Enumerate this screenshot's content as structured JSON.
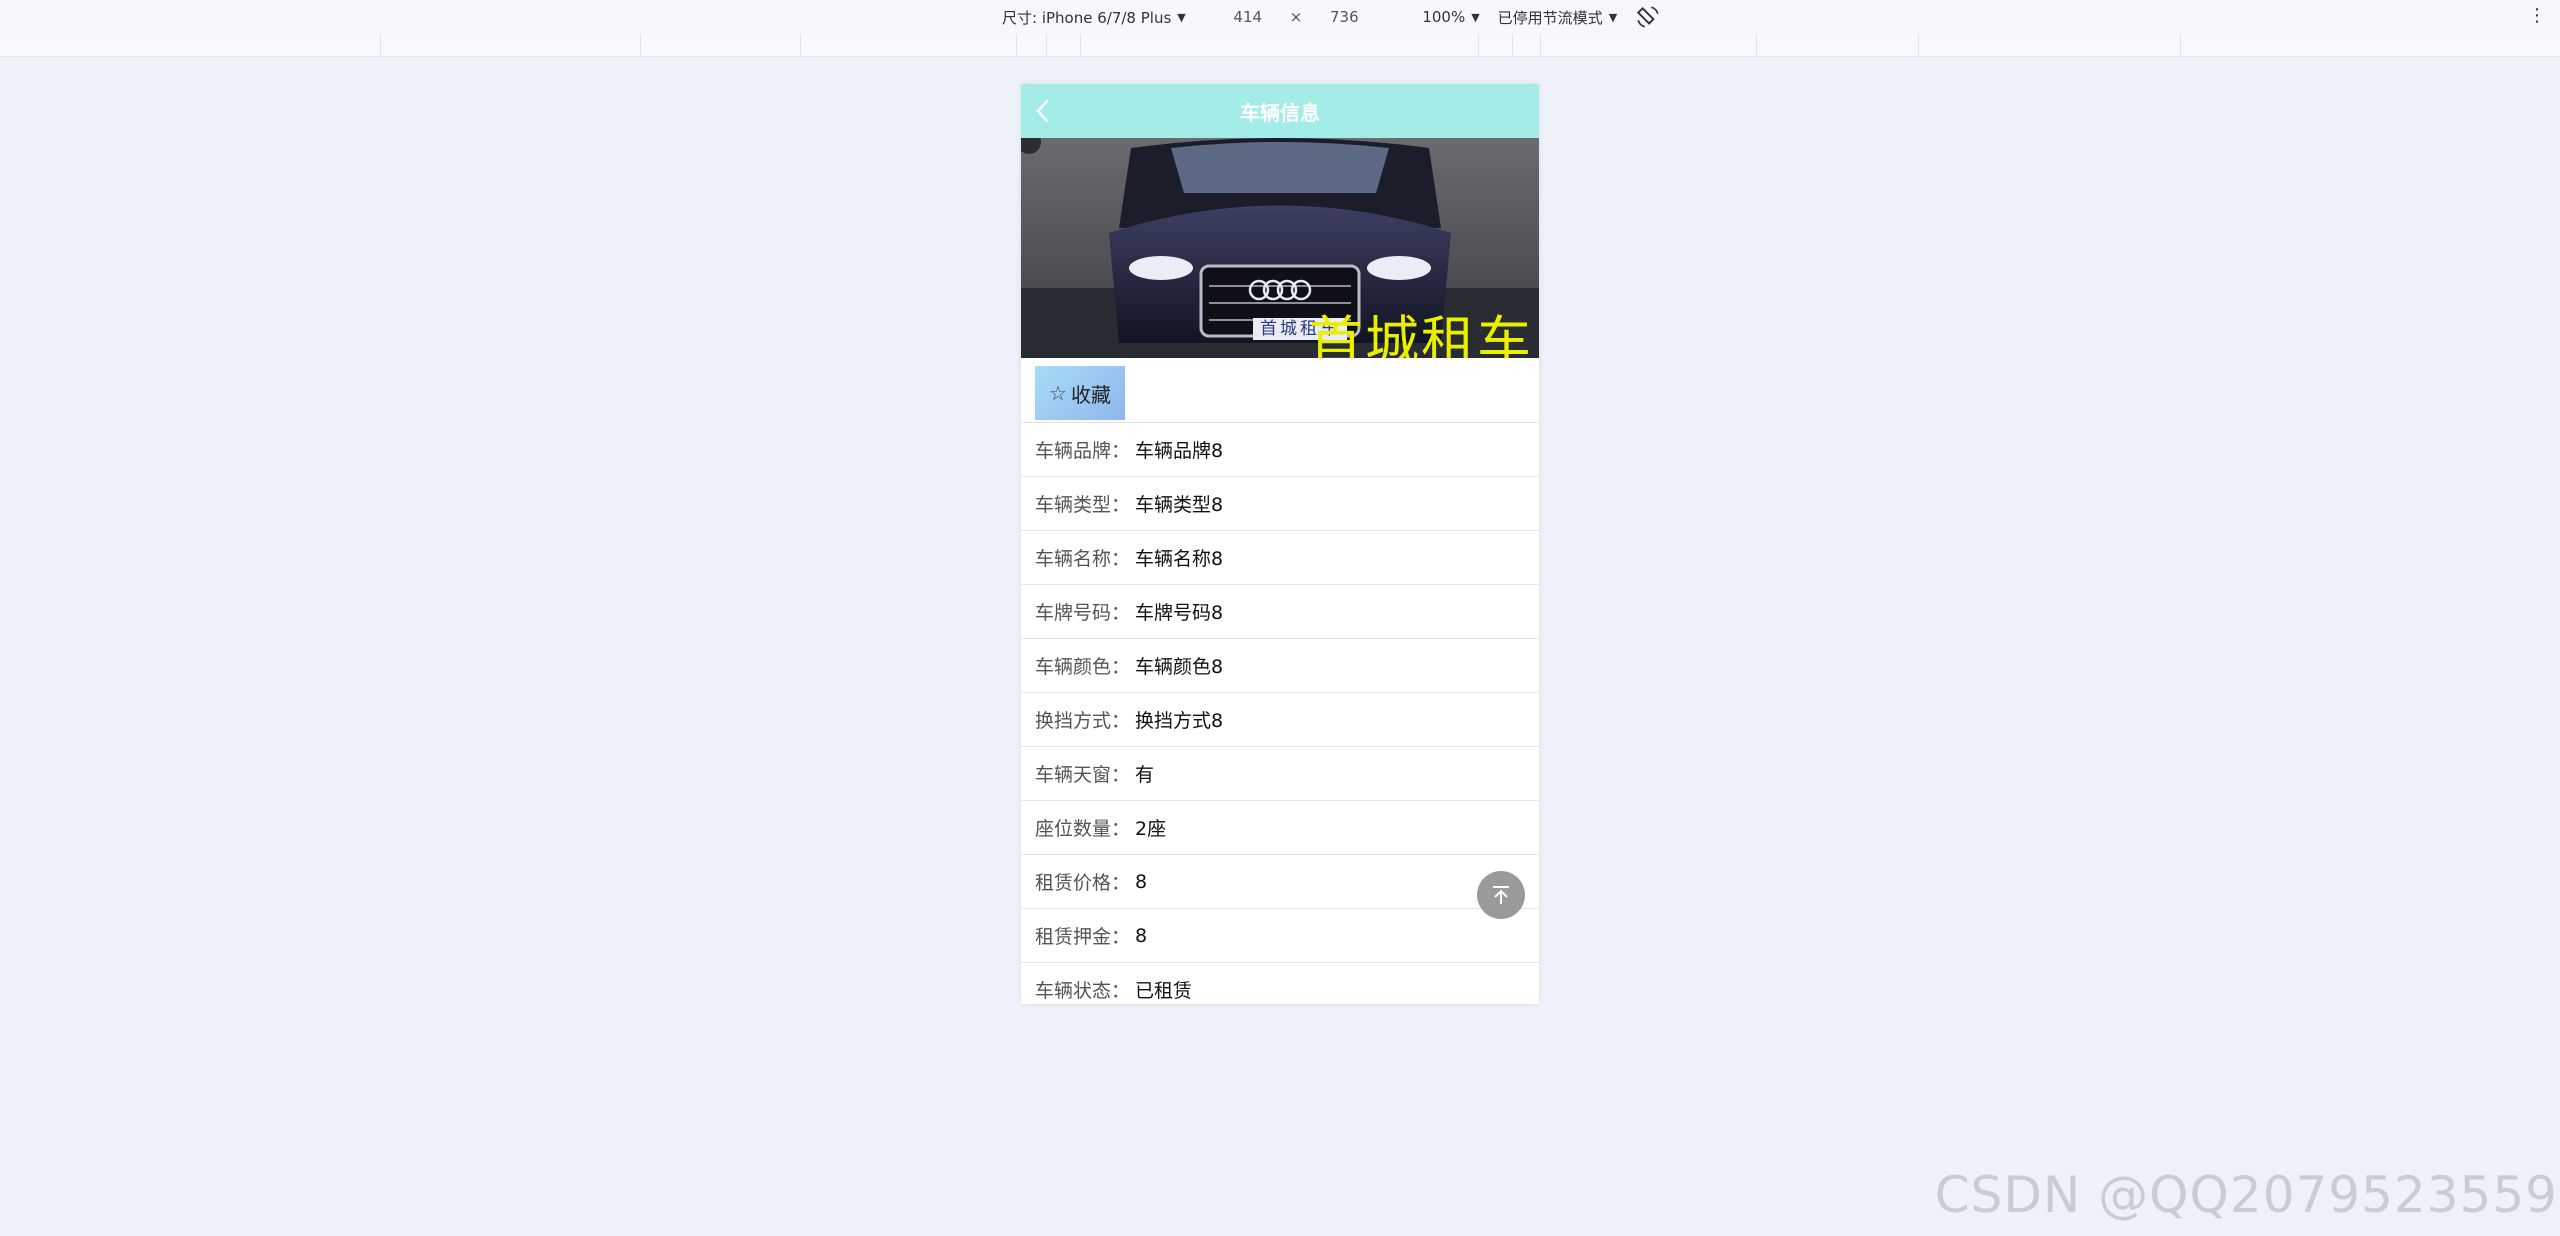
{
  "devtools": {
    "device_label": "尺寸: iPhone 6/7/8 Plus",
    "width": "414",
    "times": "×",
    "height": "736",
    "zoom": "100%",
    "throttle": "已停用节流模式"
  },
  "header": {
    "title": "车辆信息"
  },
  "hero": {
    "plate_text": "首城租车",
    "overlay_text": "首城租车"
  },
  "favorite": {
    "star": "☆",
    "label": "收藏"
  },
  "details": [
    {
      "label": "车辆品牌：",
      "value": "车辆品牌8"
    },
    {
      "label": "车辆类型：",
      "value": "车辆类型8"
    },
    {
      "label": "车辆名称：",
      "value": "车辆名称8"
    },
    {
      "label": "车牌号码：",
      "value": "车牌号码8"
    },
    {
      "label": "车辆颜色：",
      "value": "车辆颜色8"
    },
    {
      "label": "换挡方式：",
      "value": "换挡方式8"
    },
    {
      "label": "车辆天窗：",
      "value": "有"
    },
    {
      "label": "座位数量：",
      "value": "2座"
    },
    {
      "label": "租赁价格：",
      "value": "8"
    },
    {
      "label": "租赁押金：",
      "value": "8"
    },
    {
      "label": "车辆状态：",
      "value": "已租赁"
    }
  ],
  "watermark": "CSDN @QQ2079523559",
  "colors": {
    "header_bg": "#a4ece8",
    "page_bg": "#eef1f8"
  }
}
